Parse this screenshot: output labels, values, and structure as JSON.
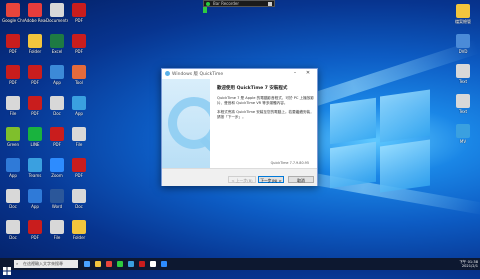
{
  "recorder": {
    "title": "Bar Recorder"
  },
  "desktop_icons": [
    {
      "label": "Google Chrome",
      "color": "#e8453c"
    },
    {
      "label": "Adobe Reader",
      "color": "#e83c3c"
    },
    {
      "label": "Documents",
      "color": "#d8d8d8"
    },
    {
      "label": "PDF",
      "color": "#c91d1d"
    },
    {
      "label": "PDF",
      "color": "#c91d1d"
    },
    {
      "label": "Folder",
      "color": "#f2c53d"
    },
    {
      "label": "Excel",
      "color": "#1e7a43"
    },
    {
      "label": "PDF",
      "color": "#c91d1d"
    },
    {
      "label": "PDF",
      "color": "#c91d1d"
    },
    {
      "label": "PDF",
      "color": "#c91d1d"
    },
    {
      "label": "App",
      "color": "#3c8ad8"
    },
    {
      "label": "Tool",
      "color": "#e36b3c"
    },
    {
      "label": "File",
      "color": "#d8d8d8"
    },
    {
      "label": "PDF",
      "color": "#c91d1d"
    },
    {
      "label": "Doc",
      "color": "#d8d8d8"
    },
    {
      "label": "App",
      "color": "#3aa0e0"
    },
    {
      "label": "Green",
      "color": "#7fbf2c"
    },
    {
      "label": "LINE",
      "color": "#19b33e"
    },
    {
      "label": "PDF",
      "color": "#c91d1d"
    },
    {
      "label": "File",
      "color": "#d8d8d8"
    },
    {
      "label": "App",
      "color": "#2f7ad8"
    },
    {
      "label": "Teams",
      "color": "#3aa0e0"
    },
    {
      "label": "Zoom",
      "color": "#2d8cff"
    },
    {
      "label": "PDF",
      "color": "#c91d1d"
    },
    {
      "label": "Doc",
      "color": "#d8d8d8"
    },
    {
      "label": "App",
      "color": "#2f7ad8"
    },
    {
      "label": "Word",
      "color": "#2b579a"
    },
    {
      "label": "Doc",
      "color": "#d8d8d8"
    },
    {
      "label": "Doc",
      "color": "#d8d8d8"
    },
    {
      "label": "PDF",
      "color": "#c91d1d"
    },
    {
      "label": "File",
      "color": "#d8d8d8"
    },
    {
      "label": "Folder",
      "color": "#f2c53d"
    }
  ],
  "right_icons": [
    {
      "label": "檔案總管",
      "color": "#f2c53d"
    },
    {
      "label": "DVD",
      "color": "#4b8bd8"
    },
    {
      "label": "Text",
      "color": "#d8d8d8"
    },
    {
      "label": "Text",
      "color": "#d8d8d8"
    },
    {
      "label": "MV",
      "color": "#3aa0e0"
    }
  ],
  "dialog": {
    "title": "Windows 版 QuickTime",
    "minimize": "–",
    "maximize": "□",
    "close": "✕",
    "heading": "歡迎使用 QuickTime 7 安裝程式",
    "para1": "QuickTime 7 是 Apple 的電腦影音程式，可於 PC 上播放影片、聲音和 QuickTime VR 等多媒體內容。",
    "para2": "本程式會將 QuickTime 安裝至您的電腦上。若要繼續安裝，請按「下一步」。",
    "version": "QuickTime 7.7.9.80.95",
    "buttons": {
      "back": "< 上一步(B)",
      "next": "下一步(N) >",
      "cancel": "取消"
    }
  },
  "taskbar": {
    "search_placeholder": "在這裡輸入文字來搜尋",
    "time": "下午 01:38",
    "date": "2021/2/1"
  }
}
